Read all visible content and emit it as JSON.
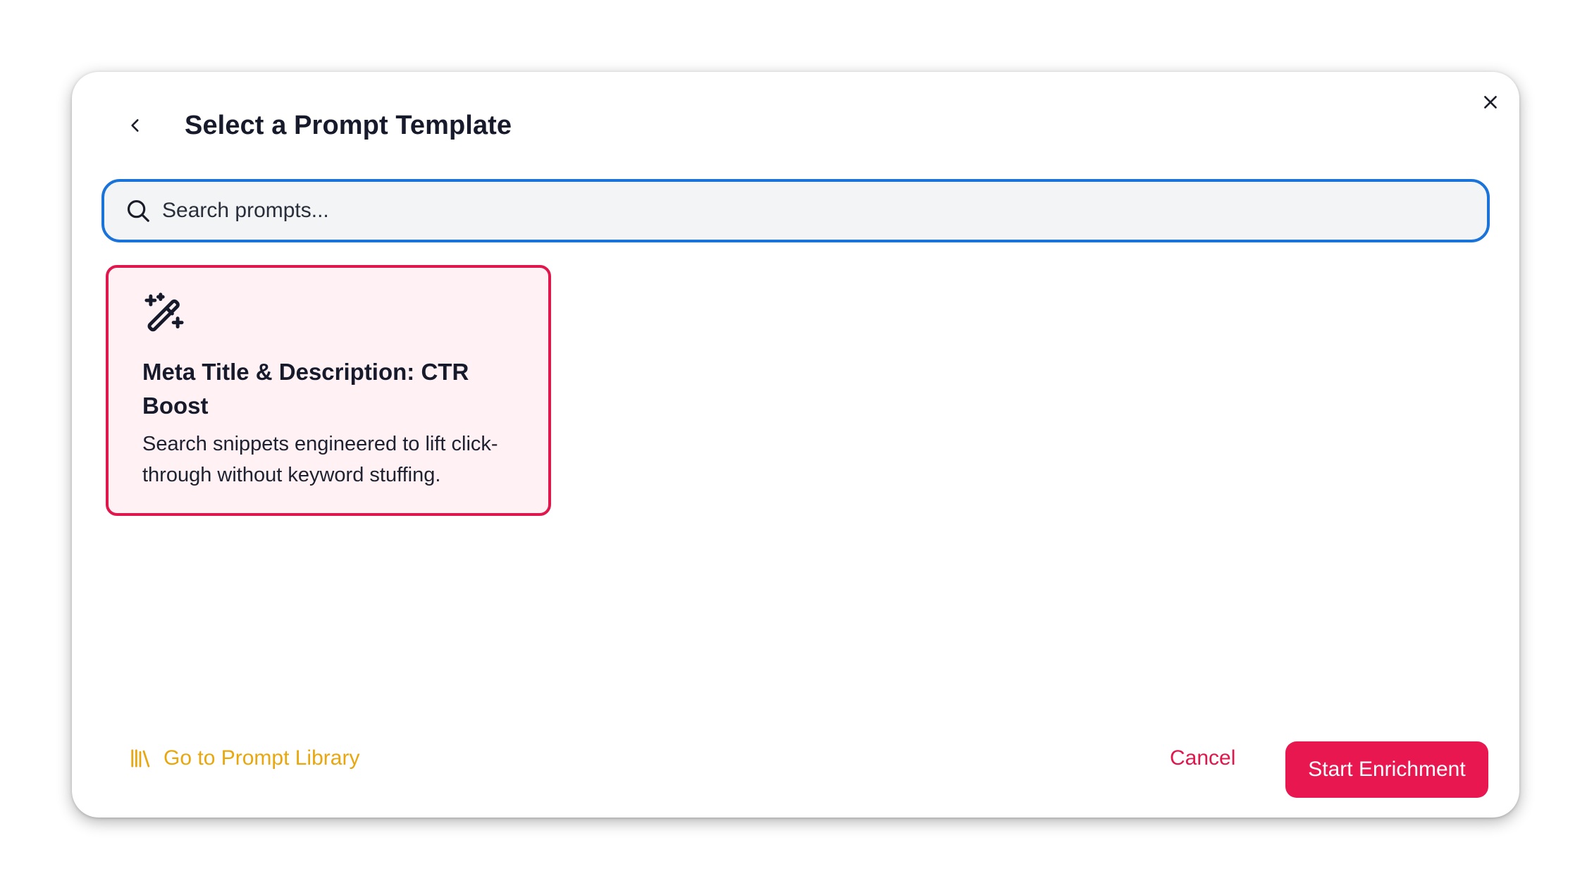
{
  "dialog": {
    "title": "Select a Prompt Template",
    "back_icon": "chevron-left-icon",
    "close_icon": "close-icon"
  },
  "search": {
    "placeholder": "Search prompts...",
    "value": "",
    "icon": "search-icon",
    "border_color": "#1a73d9"
  },
  "templates": [
    {
      "icon": "magic-wand-icon",
      "title": "Meta Title & Description: CTR Boost",
      "description": "Search snippets engineered to lift click-through without keyword stuffing.",
      "selected": true
    }
  ],
  "footer": {
    "library_label": "Go to Prompt Library",
    "library_icon": "library-icon",
    "cancel_label": "Cancel",
    "start_label": "Start Enrichment"
  },
  "colors": {
    "accent": "#e8174f",
    "library_link": "#e8a70e",
    "selected_card_bg": "#fff1f4"
  }
}
